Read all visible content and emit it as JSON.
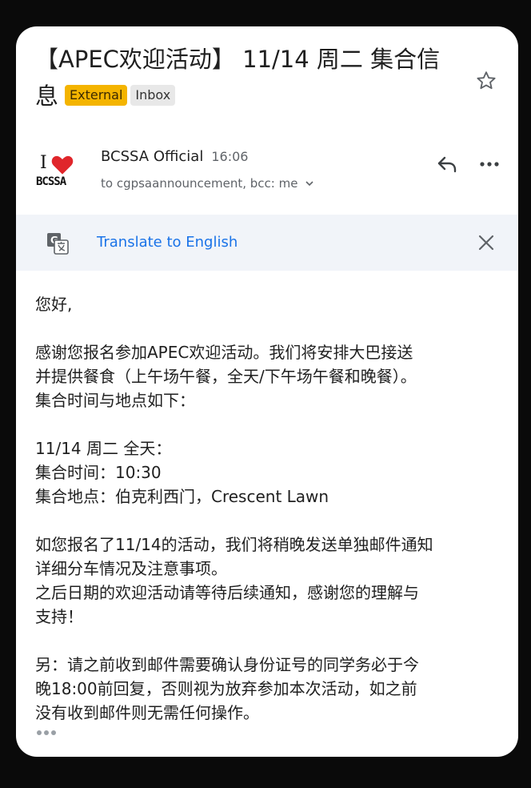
{
  "email": {
    "subject": "【APEC欢迎活动】 11/14 周二 集合信息",
    "labels": [
      "External",
      "Inbox"
    ],
    "sender": {
      "name": "BCSSA Official",
      "time": "16:06",
      "recipients": "to cgpsaannouncement, bcc: me",
      "avatar_text": "BCSSA"
    },
    "translate": {
      "label": "Translate to English"
    },
    "body": {
      "greeting": "您好,",
      "p1": [
        "感谢您报名参加APEC欢迎活动。我们将安排大巴接送",
        "并提供餐食（上午场午餐，全天/下午场午餐和晚餐）。",
        "集合时间与地点如下："
      ],
      "p2": [
        "11/14 周二 全天：",
        "集合时间：10:30",
        "集合地点：伯克利西门，Crescent Lawn"
      ],
      "p3": [
        "如您报名了11/14的活动，我们将稍晚发送单独邮件通知",
        "详细分车情况及注意事项。",
        "之后日期的欢迎活动请等待后续通知，感谢您的理解与",
        "支持！"
      ],
      "p4": [
        "另：请之前收到邮件需要确认身份证号的同学务必于今",
        "晚18:00前回复，否则视为放弃参加本次活动，如之前",
        "没有收到邮件则无需任何操作。"
      ]
    }
  },
  "colors": {
    "external_badge": "#f4b400",
    "translate_link": "#1a73e8",
    "translate_bar": "#f1f4f9"
  },
  "icons": [
    "star-icon",
    "heart-icon",
    "reply-icon",
    "more-icon",
    "translate-icon",
    "close-icon",
    "chevron-down-icon",
    "ellipsis-icon"
  ]
}
